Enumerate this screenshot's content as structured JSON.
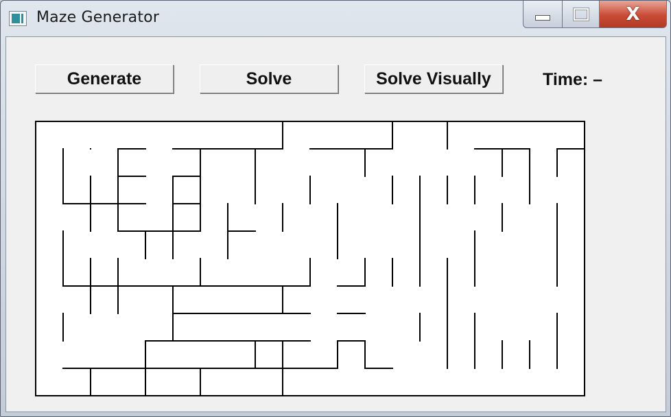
{
  "window": {
    "title": "Maze Generator",
    "close_glyph": "X"
  },
  "toolbar": {
    "generate_label": "Generate",
    "solve_label": "Solve",
    "solve_visually_label": "Solve Visually",
    "time_label": "Time: –"
  },
  "maze": {
    "columns": 20,
    "rows": 10,
    "wall_color": "#000000",
    "background_color": "#ffffff",
    "horizontal_walls": [
      [
        3,
        1,
        4,
        5
      ],
      [
        6,
        1,
        7,
        8
      ],
      [
        9,
        1,
        11,
        12
      ],
      [
        12,
        1,
        13,
        14
      ],
      [
        16,
        1,
        17,
        19
      ],
      [
        1,
        2,
        2,
        3
      ],
      [
        6,
        2,
        8,
        9
      ],
      [
        12,
        2,
        13,
        14
      ],
      [
        15,
        2,
        17,
        19
      ],
      [
        0,
        3,
        1,
        2
      ],
      [
        4,
        3,
        6,
        7
      ],
      [
        10,
        3,
        12,
        13
      ],
      [
        16,
        3,
        18,
        19
      ],
      [
        2,
        4,
        3,
        5
      ],
      [
        8,
        4,
        10,
        11
      ],
      [
        14,
        4,
        15,
        16
      ],
      [
        18,
        4,
        20
      ],
      [
        4,
        5,
        5
      ],
      [
        7,
        5,
        10,
        11
      ],
      [
        13,
        5,
        14,
        15
      ],
      [
        16,
        5,
        17,
        18
      ],
      [
        6,
        6,
        10,
        11
      ],
      [
        12,
        6,
        13,
        17
      ],
      [
        18,
        6,
        19
      ],
      [
        0,
        7,
        2,
        3,
        6,
        8,
        9,
        10,
        12,
        13,
        15,
        16,
        18
      ],
      [
        0,
        8,
        2,
        3,
        5,
        6,
        8,
        9,
        13,
        14,
        16,
        17,
        18
      ],
      [
        1,
        9,
        5,
        6,
        9,
        10,
        13,
        16,
        18,
        19,
        20
      ]
    ],
    "vertical_walls": [
      [
        9,
        0,
        1
      ],
      [
        13,
        0,
        1
      ],
      [
        15,
        0,
        1
      ],
      [
        1,
        1,
        2
      ],
      [
        3,
        1,
        2
      ],
      [
        6,
        1,
        2
      ],
      [
        8,
        1,
        2
      ],
      [
        12,
        1,
        2
      ],
      [
        17,
        1,
        2
      ],
      [
        18,
        1,
        2
      ],
      [
        19,
        1,
        2
      ],
      [
        1,
        2,
        3
      ],
      [
        2,
        2,
        3
      ],
      [
        3,
        2,
        3
      ],
      [
        5,
        2,
        3
      ],
      [
        6,
        2,
        3
      ],
      [
        8,
        2,
        3
      ],
      [
        10,
        2,
        3
      ],
      [
        13,
        2,
        3
      ],
      [
        14,
        2,
        3
      ],
      [
        15,
        2,
        3
      ],
      [
        16,
        2,
        3
      ],
      [
        18,
        2,
        3
      ],
      [
        2,
        3,
        4
      ],
      [
        3,
        3,
        4
      ],
      [
        5,
        3,
        4
      ],
      [
        6,
        3,
        4
      ],
      [
        7,
        3,
        4
      ],
      [
        9,
        3,
        4
      ],
      [
        11,
        3,
        4
      ],
      [
        14,
        3,
        4
      ],
      [
        17,
        3,
        4
      ],
      [
        19,
        3,
        4
      ],
      [
        1,
        4,
        5
      ],
      [
        4,
        4,
        5
      ],
      [
        5,
        4,
        5
      ],
      [
        7,
        4,
        5
      ],
      [
        11,
        4,
        5
      ],
      [
        14,
        4,
        5
      ],
      [
        16,
        4,
        5
      ],
      [
        19,
        4,
        5
      ],
      [
        1,
        5,
        6
      ],
      [
        2,
        5,
        6
      ],
      [
        3,
        5,
        6
      ],
      [
        6,
        5,
        6
      ],
      [
        10,
        5,
        6
      ],
      [
        12,
        5,
        6
      ],
      [
        13,
        5,
        6
      ],
      [
        14,
        5,
        6
      ],
      [
        15,
        5,
        6
      ],
      [
        16,
        5,
        6
      ],
      [
        19,
        5,
        6
      ],
      [
        2,
        6,
        7
      ],
      [
        3,
        6,
        7
      ],
      [
        5,
        6,
        7
      ],
      [
        9,
        6,
        7
      ],
      [
        15,
        6,
        7
      ],
      [
        1,
        7,
        8
      ],
      [
        5,
        7,
        8
      ],
      [
        14,
        7,
        8
      ],
      [
        15,
        7,
        8
      ],
      [
        16,
        7,
        8
      ],
      [
        19,
        7,
        8
      ],
      [
        4,
        8,
        9
      ],
      [
        8,
        8,
        9
      ],
      [
        9,
        8,
        9
      ],
      [
        11,
        8,
        9
      ],
      [
        12,
        8,
        9
      ],
      [
        15,
        8,
        9
      ],
      [
        16,
        8,
        9
      ],
      [
        17,
        8,
        9
      ],
      [
        18,
        8,
        9
      ],
      [
        19,
        8,
        9
      ],
      [
        2,
        9,
        10
      ],
      [
        4,
        9,
        10
      ],
      [
        6,
        9,
        10
      ],
      [
        9,
        9,
        10
      ]
    ]
  }
}
